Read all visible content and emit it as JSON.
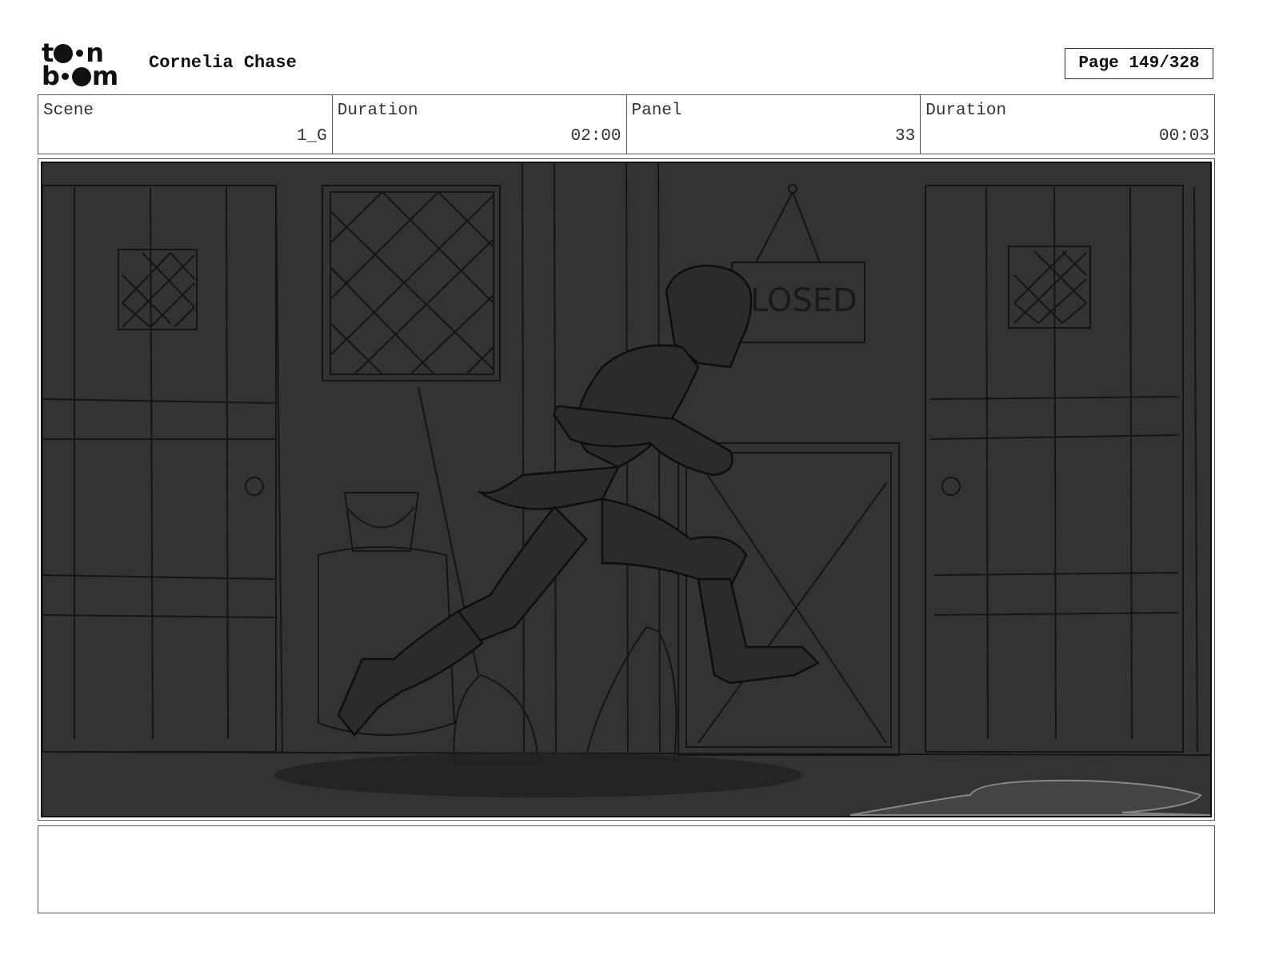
{
  "header": {
    "logo_text": "toon boom",
    "project_title": "Cornelia Chase",
    "page_label": "Page 149/328"
  },
  "info": {
    "scene": {
      "label": "Scene",
      "value": "1_G"
    },
    "scene_duration": {
      "label": "Duration",
      "value": "02:00"
    },
    "panel": {
      "label": "Panel",
      "value": "33"
    },
    "panel_duration": {
      "label": "Duration",
      "value": "00:03"
    }
  },
  "panel_art": {
    "sign_text": "LOSED",
    "background_color": "#333333"
  },
  "notes": {
    "text": ""
  }
}
